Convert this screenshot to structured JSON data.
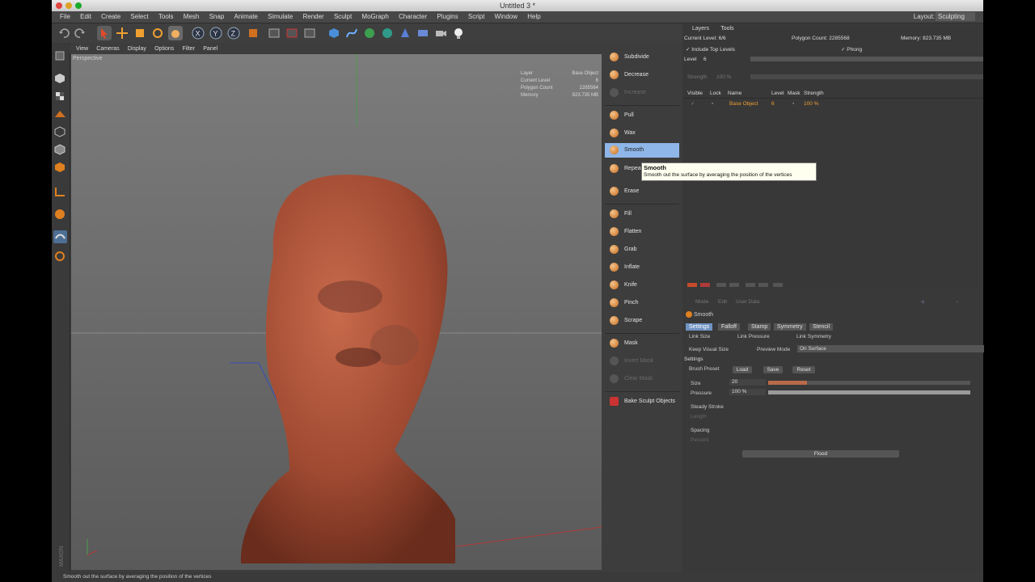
{
  "window": {
    "title": "Untitled 3 *"
  },
  "menu": [
    "File",
    "Edit",
    "Create",
    "Select",
    "Tools",
    "Mesh",
    "Snap",
    "Animate",
    "Simulate",
    "Render",
    "Sculpt",
    "MoGraph",
    "Character",
    "Plugins",
    "Script",
    "Window",
    "Help"
  ],
  "layout": {
    "label": "Layout:",
    "value": "Sculpting"
  },
  "viewport": {
    "menu": [
      "View",
      "Cameras",
      "Display",
      "Options",
      "Filter",
      "Panel"
    ],
    "label": "Perspective",
    "hud": {
      "layer_label": "Layer",
      "layer_value": "Base Object",
      "level_label": "Current Level",
      "level_value": "6",
      "poly_label": "Polygon Count",
      "poly_value": "2285564",
      "mem_label": "Memory",
      "mem_value": "823.735 MB"
    }
  },
  "brushes": {
    "subdivide": "Subdivide",
    "decrease": "Decrease",
    "increase": "Increase",
    "pull": "Pull",
    "wax": "Wax",
    "smooth": "Smooth",
    "repeat": "Repeat",
    "erase": "Erase",
    "fill": "Fill",
    "flatten": "Flatten",
    "grab": "Grab",
    "inflate": "Inflate",
    "knife": "Knife",
    "pinch": "Pinch",
    "scrape": "Scrape",
    "mask": "Mask",
    "invert_mask": "Invert Mask",
    "clear_mask": "Clear Mask",
    "bake": "Bake Sculpt Objects"
  },
  "tooltip": {
    "title": "Smooth",
    "text": "Smooth out the surface by averaging the position of the vertices"
  },
  "layers": {
    "tabs": [
      "Layers",
      "Tools"
    ],
    "current_level": "Current Level: 6/6",
    "polygon_count": "Polygon Count: 2285568",
    "memory": "Memory: 823.735 MB",
    "include_top": "Include Top Levels",
    "phong": "Phong",
    "level_label": "Level",
    "level_value": "6",
    "strength_label": "Strength",
    "strength_value": "100 %",
    "columns": [
      "Visible",
      "Lock",
      "Name",
      "Level",
      "Mask",
      "Strength"
    ],
    "rows": [
      {
        "name": "Base Object",
        "level": "6",
        "strength": "100 %"
      }
    ]
  },
  "attributes": {
    "menu": [
      "Mode",
      "Edit",
      "User Data"
    ],
    "title": "Smooth",
    "tabs": [
      "Settings",
      "Falloff",
      "Stamp",
      "Symmetry",
      "Stencil"
    ],
    "link_size": "Link Size",
    "link_pressure": "Link Pressure",
    "link_symmetry": "Link Symmetry",
    "keep_visual_size": "Keep Visual Size",
    "preview_mode_label": "Preview Mode",
    "preview_mode_value": "On Surface",
    "settings_header": "Settings",
    "brush_preset": "Brush Preset",
    "load": "Load",
    "save": "Save",
    "reset": "Reset",
    "size_label": "Size",
    "size_value": "20",
    "size_fraction": 0.19,
    "pressure_label": "Pressure",
    "pressure_value": "100 %",
    "pressure_fraction": 1.0,
    "steady_stroke": "Steady Stroke",
    "length_label": "Length",
    "length_value": "",
    "spacing": "Spacing",
    "percent_label": "Percent",
    "percent_value": "",
    "flood": "Flood"
  },
  "status": {
    "text": "Smooth out the surface by averaging the position of the vertices"
  }
}
